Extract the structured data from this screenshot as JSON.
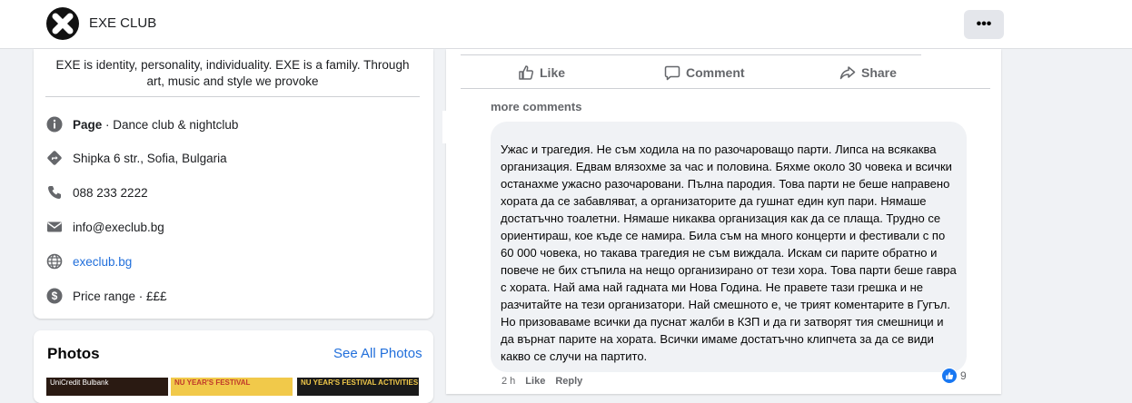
{
  "header": {
    "club_name": "EXE CLUB",
    "more_label": "•••"
  },
  "info": {
    "about": "EXE is identity, personality, individuality. EXE is a family. Through art, music and style we provoke",
    "page_label": "Page",
    "page_category": " · Dance club & nightclub",
    "address": "Shipka 6 str., Sofia, Bulgaria",
    "phone": "088 233 2222",
    "email": "info@execlub.bg",
    "website": "execlub.bg",
    "price": "Price range · £££"
  },
  "photos": {
    "title": "Photos",
    "see_all": "See All Photos",
    "thumbs": [
      "UniCredit Bulbank",
      "NU YEAR'S FESTIVAL",
      "NU YEAR'S FESTIVAL ACTIVITIES"
    ]
  },
  "post": {
    "actions": {
      "like": "Like",
      "comment": "Comment",
      "share": "Share"
    },
    "more_comments": "more comments"
  },
  "comment": {
    "text": "Ужас и трагедия. Не съм ходила на по разочароващо парти. Липса на всякаква организация. Едвам влязохме за час и половина. Бяхме около 30 човека и всички останахме ужасно разочаровани. Пълна пародия. Това парти не беше направено хората да се забавляват, а организаторите да гушнат един куп пари. Нямаше достатъчно тоалетни. Нямаше никаква организация как да се плаща. Трудно се ориентираш, кое къде се намира. Била съм на много концерти и фестивали с по 60 000 човека, но такава трагедия не съм виждала. Искам си парите обратно и повече не бих стъпила на нещо организирано от тези хора. Това парти беше гавра с хората. Най ама най гадната ми Нова Година. Не правете тази грешка и не разчитайте на тези организатори. Най смешното е, че трият коментарите в Гугъл.\nНо призоваваме всички да пуснат жалби в КЗП и да ги затворят тия смешници и да върнат парите на хората. Всички имаме достатъчно клипчета за да се види какво се случи на партито.",
    "time": "2 h",
    "like": "Like",
    "reply": "Reply",
    "reaction_count": "9"
  },
  "colors": {
    "background": "#f0f2f5",
    "link": "#216fdb",
    "secondary_text": "#65676b",
    "like_blue": "#1877f2"
  }
}
